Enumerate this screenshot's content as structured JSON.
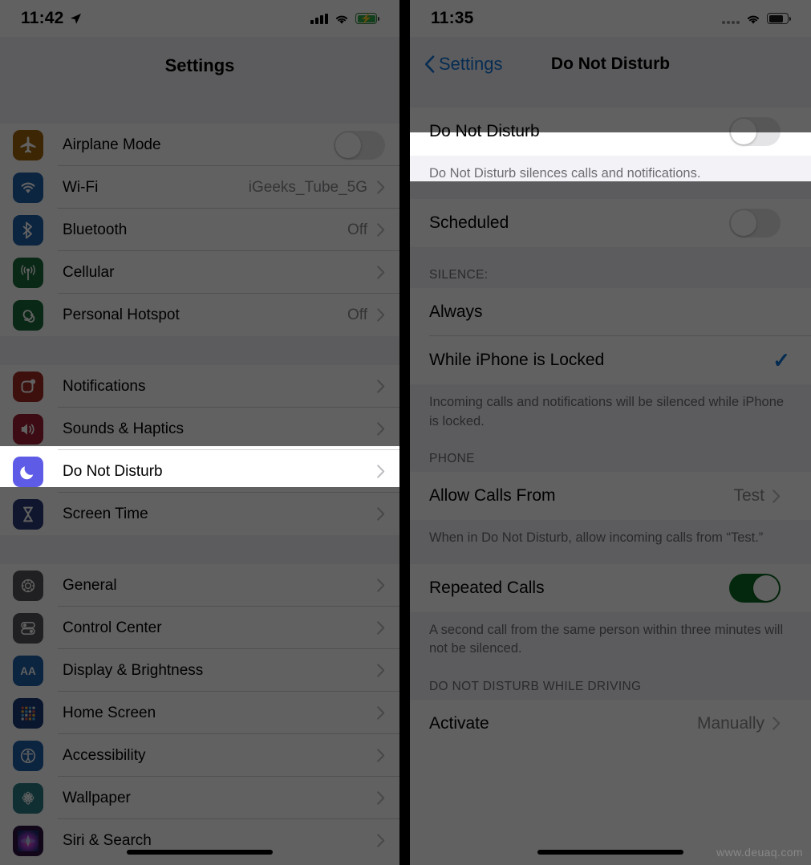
{
  "left_phone": {
    "status_bar": {
      "time": "11:42",
      "location_icon": "location-arrow-icon",
      "signal_icon": "cellular-bars-icon",
      "wifi_icon": "wifi-icon",
      "battery_icon": "battery-charging-icon",
      "battery_color": "#33c759"
    },
    "nav": {
      "title": "Settings"
    },
    "groups": [
      {
        "rows": [
          {
            "label": "Airplane Mode",
            "icon": "airplane-icon",
            "icon_color": "#a0640a",
            "accessory": "toggle",
            "toggle_on": false
          },
          {
            "label": "Wi-Fi",
            "icon": "wifi-icon",
            "icon_color": "#1f5fa8",
            "accessory": "chevron",
            "value": "iGeeks_Tube_5G"
          },
          {
            "label": "Bluetooth",
            "icon": "bluetooth-icon",
            "icon_color": "#1f5fa8",
            "accessory": "chevron",
            "value": "Off"
          },
          {
            "label": "Cellular",
            "icon": "cellular-antenna-icon",
            "icon_color": "#1c6b3a",
            "accessory": "chevron",
            "value": ""
          },
          {
            "label": "Personal Hotspot",
            "icon": "hotspot-icon",
            "icon_color": "#1c6b3a",
            "accessory": "chevron",
            "value": "Off"
          }
        ]
      },
      {
        "rows": [
          {
            "label": "Notifications",
            "icon": "notifications-icon",
            "icon_color": "#a12a24",
            "accessory": "chevron",
            "value": ""
          },
          {
            "label": "Sounds & Haptics",
            "icon": "sounds-icon",
            "icon_color": "#9e1f34",
            "accessory": "chevron",
            "value": ""
          },
          {
            "label": "Do Not Disturb",
            "icon": "moon-icon",
            "icon_color": "#5e5ce6",
            "accessory": "chevron",
            "value": "",
            "highlighted": true
          },
          {
            "label": "Screen Time",
            "icon": "hourglass-icon",
            "icon_color": "#2b3a77",
            "accessory": "chevron",
            "value": ""
          }
        ]
      },
      {
        "rows": [
          {
            "label": "General",
            "icon": "gear-icon",
            "icon_color": "#55555a",
            "accessory": "chevron",
            "value": ""
          },
          {
            "label": "Control Center",
            "icon": "control-center-icon",
            "icon_color": "#55555a",
            "accessory": "chevron",
            "value": ""
          },
          {
            "label": "Display & Brightness",
            "icon": "display-brightness-icon",
            "icon_color": "#1f5fa8",
            "accessory": "chevron",
            "value": ""
          },
          {
            "label": "Home Screen",
            "icon": "home-screen-icon",
            "icon_color": "#1b3a78",
            "accessory": "chevron",
            "value": ""
          },
          {
            "label": "Accessibility",
            "icon": "accessibility-icon",
            "icon_color": "#1f5fa8",
            "accessory": "chevron",
            "value": ""
          },
          {
            "label": "Wallpaper",
            "icon": "wallpaper-icon",
            "icon_color": "#2b7d87",
            "accessory": "chevron",
            "value": ""
          },
          {
            "label": "Siri & Search",
            "icon": "siri-icon",
            "icon_color": "#2d1440",
            "accessory": "chevron",
            "value": ""
          }
        ]
      }
    ]
  },
  "right_phone": {
    "status_bar": {
      "time": "11:35",
      "signal_icon": "cellular-dots-icon",
      "wifi_icon": "wifi-icon",
      "battery_icon": "battery-icon"
    },
    "nav": {
      "back_label": "Settings",
      "back_icon": "chevron-left-icon",
      "title": "Do Not Disturb"
    },
    "main_toggle": {
      "label": "Do Not Disturb",
      "on": false
    },
    "main_footnote": "Do Not Disturb silences calls and notifications.",
    "scheduled": {
      "label": "Scheduled",
      "on": false
    },
    "silence": {
      "header": "SILENCE:",
      "options": [
        {
          "label": "Always",
          "selected": false
        },
        {
          "label": "While iPhone is Locked",
          "selected": true
        }
      ],
      "footnote": "Incoming calls and notifications will be silenced while iPhone is locked."
    },
    "phone_section": {
      "header": "PHONE",
      "allow_calls": {
        "label": "Allow Calls From",
        "value": "Test"
      },
      "allow_calls_footnote": "When in Do Not Disturb, allow incoming calls from “Test.”",
      "repeated_calls": {
        "label": "Repeated Calls",
        "on": true
      },
      "repeated_calls_footnote": "A second call from the same person within three minutes will not be silenced."
    },
    "driving_section": {
      "header": "DO NOT DISTURB WHILE DRIVING",
      "activate": {
        "label": "Activate",
        "value": "Manually"
      }
    },
    "check_mark": "✓"
  },
  "watermark": "www.deuaq.com",
  "colors": {
    "accent_blue": "#0b72d4",
    "toggle_green": "#0b6b22",
    "dim": "rgba(0,0,0,0.62)"
  }
}
